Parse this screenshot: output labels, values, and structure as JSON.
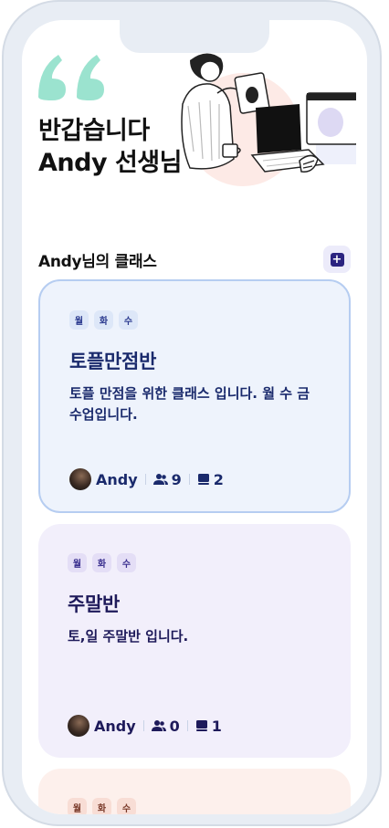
{
  "greeting": {
    "line1": "반갑습니다",
    "line2": "Andy 선생님"
  },
  "section": {
    "title": "Andy님의 클래스",
    "add_label": "+"
  },
  "classes": [
    {
      "days": [
        "월",
        "화",
        "수"
      ],
      "name": "토플만점반",
      "description": "토플 만점을 위한 클래스 입니다. 월 수 금 수업입니다.",
      "teacher": "Andy",
      "students": "9",
      "lessons": "2"
    },
    {
      "days": [
        "월",
        "화",
        "수"
      ],
      "name": "주말반",
      "description": "토,일 주말반 입니다.",
      "teacher": "Andy",
      "students": "0",
      "lessons": "1"
    },
    {
      "days": [
        "월",
        "화",
        "수"
      ]
    }
  ],
  "colors": {
    "accent": "#2b2380",
    "quote": "#9be3cf",
    "card1_bg": "#eef3fc",
    "card2_bg": "#f2effb",
    "card3_bg": "#fdf0ec"
  },
  "icons": {
    "quote": "quote-mark-icon",
    "add": "plus-square-icon",
    "students": "users-icon",
    "lessons": "book-icon"
  }
}
